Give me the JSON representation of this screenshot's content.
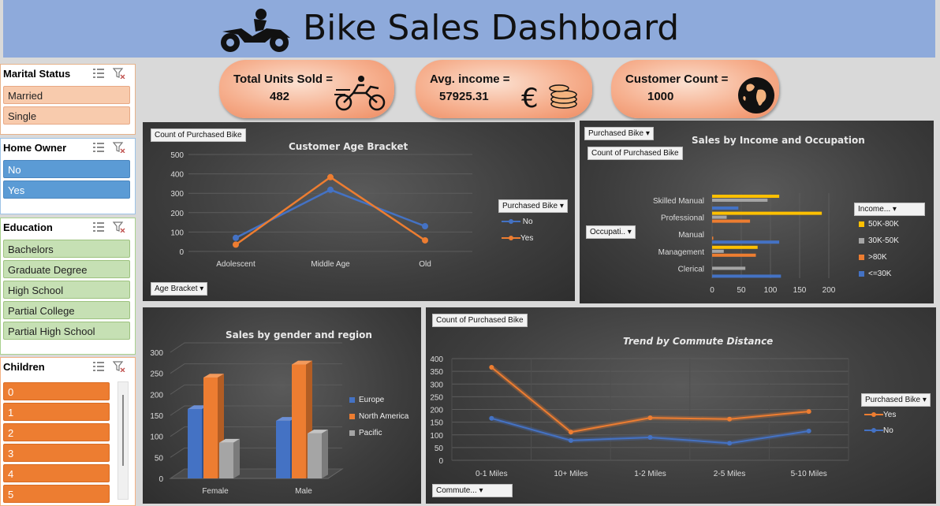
{
  "header": {
    "title": "Bike Sales Dashboard",
    "icon": "motorbike-rider-icon"
  },
  "kpis": [
    {
      "label": "Total Units Sold =",
      "value": "482",
      "icon": "motorbike-icon"
    },
    {
      "label": "Avg. income =",
      "value": "57925.31",
      "icon": "euro-coins-icon"
    },
    {
      "label": "Customer Count =",
      "value": "1000",
      "icon": "globe-icon"
    }
  ],
  "slicers": {
    "marital": {
      "title": "Marital Status",
      "items": [
        "Married",
        "Single"
      ]
    },
    "home": {
      "title": "Home Owner",
      "items": [
        "No",
        "Yes"
      ]
    },
    "education": {
      "title": "Education",
      "items": [
        "Bachelors",
        "Graduate Degree",
        "High School",
        "Partial College",
        "Partial High School"
      ]
    },
    "children": {
      "title": "Children",
      "items": [
        "0",
        "1",
        "2",
        "3",
        "4",
        "5"
      ]
    }
  },
  "colors": {
    "blue": "#4472c4",
    "orange": "#ed7d31",
    "gray": "#a5a5a5",
    "gold": "#ffc000",
    "header": "#8eaadb"
  },
  "chart_data": [
    {
      "type": "line",
      "title": "Customer Age Bracket",
      "field_tag": "Count of Purchased Bike",
      "axis_tag": "Age Bracket",
      "legend_title": "Purchased Bike",
      "categories": [
        "Adolescent",
        "Middle Age",
        "Old"
      ],
      "ylim": [
        0,
        500
      ],
      "yticks": [
        "500",
        "400",
        "300",
        "200",
        "100",
        "0"
      ],
      "series": [
        {
          "name": "No",
          "values": [
            70,
            318,
            130
          ]
        },
        {
          "name": "Yes",
          "values": [
            35,
            383,
            57
          ]
        }
      ]
    },
    {
      "type": "bar",
      "title": "Sales by Income and Occupation",
      "filter_tag": "Purchased Bike",
      "field_tag": "Count of Purchased Bike",
      "axis_tag": "Occupati..",
      "legend_title": "Income...",
      "categories": [
        "Skilled Manual",
        "Professional",
        "Manual",
        "Management",
        "Clerical"
      ],
      "xlim": [
        0,
        200
      ],
      "xticks": [
        "0",
        "50",
        "100",
        "150",
        "200"
      ],
      "series": [
        {
          "name": "50K-80K",
          "values": [
            115,
            188,
            0,
            78,
            0
          ]
        },
        {
          "name": "30K-50K",
          "values": [
            95,
            25,
            0,
            20,
            57
          ]
        },
        {
          "name": ">80K",
          "values": [
            0,
            65,
            2,
            75,
            0
          ]
        },
        {
          "name": "<=30K",
          "values": [
            45,
            0,
            115,
            0,
            118
          ]
        }
      ]
    },
    {
      "type": "bar",
      "title": "Sales by gender and  region",
      "categories": [
        "Female",
        "Male"
      ],
      "ylim": [
        0,
        300
      ],
      "yticks": [
        "300",
        "250",
        "200",
        "150",
        "100",
        "50",
        "0"
      ],
      "series": [
        {
          "name": "Europe",
          "values": [
            165,
            137
          ]
        },
        {
          "name": "North America",
          "values": [
            240,
            271
          ]
        },
        {
          "name": "Pacific",
          "values": [
            85,
            107
          ]
        }
      ]
    },
    {
      "type": "line",
      "title": "Trend by Commute Distance",
      "field_tag": "Count of Purchased Bike",
      "axis_tag": "Commute...",
      "legend_title": "Purchased Bike",
      "categories": [
        "0-1 Miles",
        "10+ Miles",
        "1-2 Miles",
        "2-5 Miles",
        "5-10 Miles"
      ],
      "ylim": [
        0,
        400
      ],
      "yticks": [
        "400",
        "350",
        "300",
        "250",
        "200",
        "150",
        "100",
        "50",
        "0"
      ],
      "series": [
        {
          "name": "Yes",
          "values": [
            366,
            111,
            167,
            162,
            192
          ]
        },
        {
          "name": "No",
          "values": [
            165,
            78,
            90,
            67,
            115
          ]
        }
      ]
    }
  ]
}
